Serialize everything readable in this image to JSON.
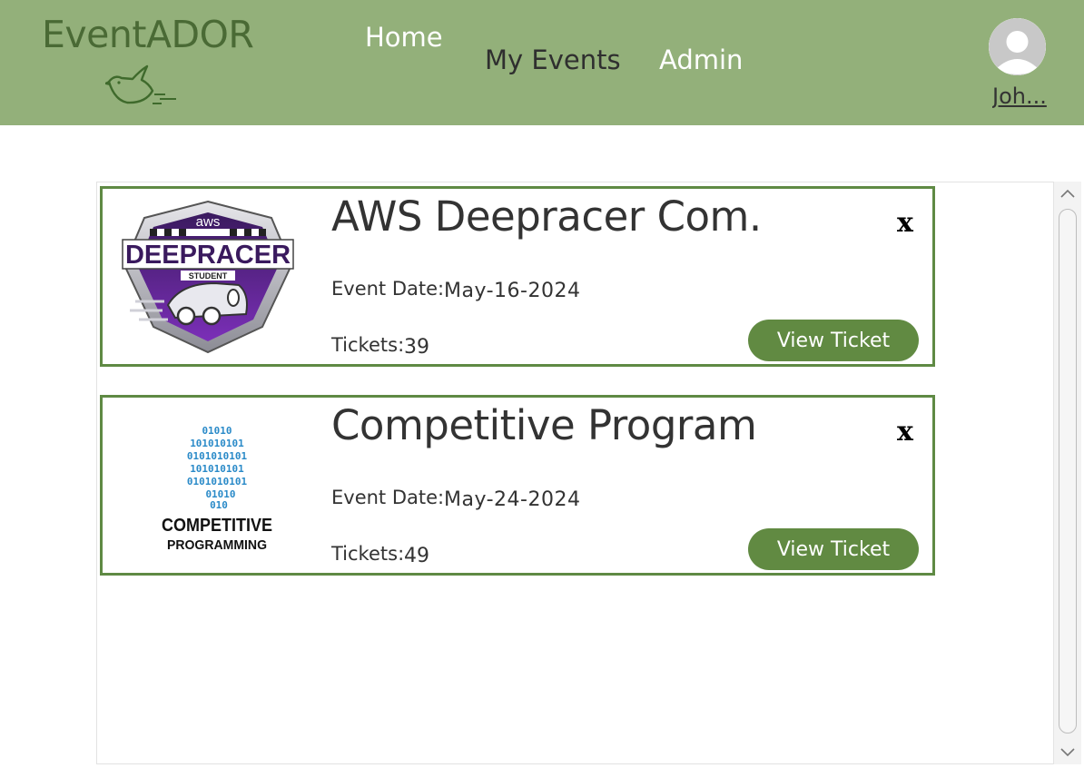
{
  "header": {
    "brand": "EventADOR",
    "brand_logo_icon": "flying-bird-icon",
    "nav": [
      {
        "label": "Home",
        "active": true
      },
      {
        "label": "My Events",
        "active": false
      },
      {
        "label": "Admin",
        "active": false
      }
    ],
    "user": {
      "name": "Joh...",
      "avatar_icon": "user-avatar-icon"
    }
  },
  "events": [
    {
      "title": "AWS Deepracer Com...",
      "image_icon": "aws-deepracer-student-logo",
      "image_text": {
        "top": "aws",
        "main": "DEEPRACER",
        "sub": "STUDENT"
      },
      "date_label": "Event Date:",
      "date": "May-16-2024",
      "tickets_label": "Tickets:",
      "tickets": "39",
      "button_label": "View Ticket",
      "remove_label": "x"
    },
    {
      "title": "Competitive Program...",
      "image_icon": "competitive-programming-logo",
      "image_text": {
        "binary": [
          "01010",
          "101010101",
          "0101010101",
          "101010101",
          "0101010101",
          "01010",
          "010"
        ],
        "main": "COMPETITIVE",
        "sub": "PROGRAMMING"
      },
      "date_label": "Event Date:",
      "date": "May-24-2024",
      "tickets_label": "Tickets:",
      "tickets": "49",
      "button_label": "View Ticket",
      "remove_label": "x"
    }
  ],
  "colors": {
    "header_bg": "#93b07a",
    "accent": "#618a42",
    "card_border": "#5f8a44",
    "brand_text": "#4a6a35"
  }
}
